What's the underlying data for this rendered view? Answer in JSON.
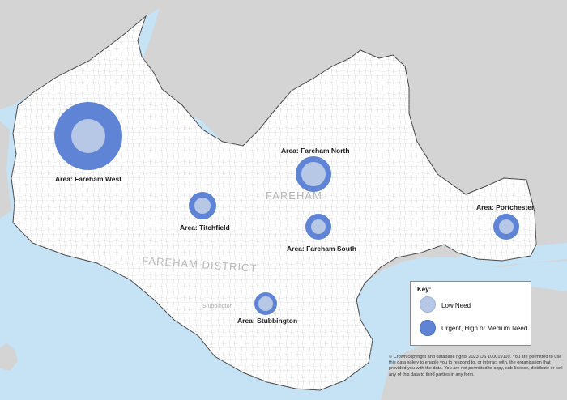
{
  "map": {
    "faint_labels": {
      "town": "FAREHAM",
      "district": "FAREHAM DISTRICT",
      "stubbington": "Stubbington"
    },
    "areas": [
      {
        "name": "Area: Fareham West",
        "outer_need": "Urgent, High or Medium Need",
        "inner_need": "Low Need"
      },
      {
        "name": "Area: Fareham North",
        "outer_need": "Urgent, High or Medium Need",
        "inner_need": "Low Need"
      },
      {
        "name": "Area: Titchfield",
        "outer_need": "Urgent, High or Medium Need",
        "inner_need": "Low Need"
      },
      {
        "name": "Area: Fareham South",
        "outer_need": "Urgent, High or Medium Need",
        "inner_need": "Low Need"
      },
      {
        "name": "Area: Portchester",
        "outer_need": "Urgent, High or Medium Need",
        "inner_need": "Low Need"
      },
      {
        "name": "Area: Stubbington",
        "outer_need": "Urgent, High or Medium Need",
        "inner_need": "Low Need"
      }
    ]
  },
  "key": {
    "title": "Key:",
    "low_label": "Low Need",
    "urgent_label": "Urgent, High or Medium Need"
  },
  "colors": {
    "sea": "#c6e2f5",
    "land_outside": "#d4d4d4",
    "district_fill": "#ffffff",
    "low_need": "#b6c8e6",
    "urgent_need": "#5f84d5"
  },
  "copyright": "© Crown copyright and database rights 2023 OS 100019110. You are permitted to use this data solely to enable you to respond to, or interact with, the organisation that provided you with the data. You are not permitted to copy, sub-licence, distribute or sell any of this data to third parties in any form."
}
